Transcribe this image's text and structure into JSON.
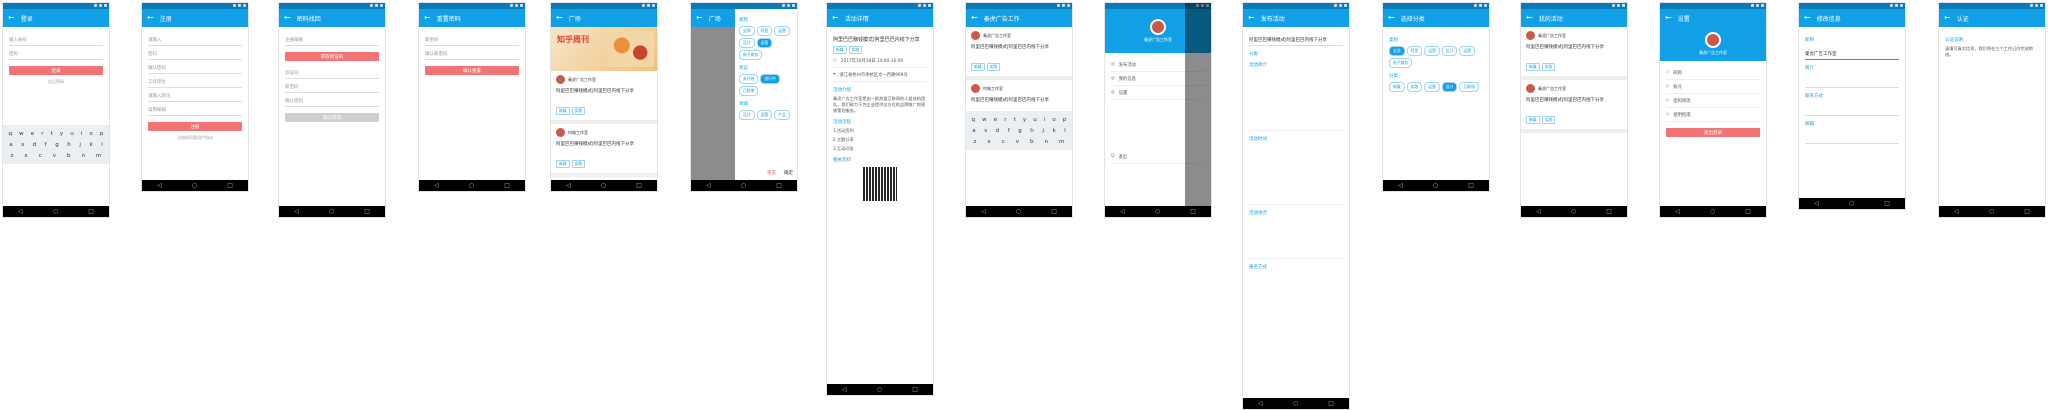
{
  "frames": [
    {
      "title": "登录",
      "f1": "输入账号",
      "f2": "密码",
      "btn": "登录",
      "link": "忘记密码"
    },
    {
      "title": "注册",
      "f1": "请输入",
      "f2": "密码",
      "f3": "确认密码",
      "f4": "工作单位",
      "f5": "请输入职位",
      "f6": "常用邮箱",
      "btn": "注册",
      "link": "注册即同意用户协议"
    },
    {
      "title": "密码找回",
      "f1": "注册邮箱",
      "btn1": "获取验证码",
      "f2": "验证码",
      "f3": "新密码",
      "f4": "确认密码",
      "btn2": "确认修改"
    },
    {
      "title": "重置密码",
      "f1": "新密码",
      "f2": "确认新密码",
      "btn": "确认重置"
    },
    {
      "title": "广场",
      "banner": "知乎周刊",
      "card1": {
        "name": "秦虎广告工作室",
        "text": "阿里巴巴赚钱模式|阿里巴巴内线下分享",
        "tags": [
          "新媒",
          "实践"
        ]
      },
      "card2": {
        "name": "何城工作室",
        "text": "阿里巴巴赚钱模式|阿里巴巴内线下分享",
        "tags": [
          "新媒",
          "实践"
        ]
      }
    },
    {
      "title": "广场",
      "s1": "类别",
      "c1": [
        "全部",
        "阿里",
        "运营",
        "设计",
        "运营",
        "电子商务"
      ],
      "s2": "状态",
      "c2": [
        "未开始",
        "进行中",
        "已结束"
      ],
      "s3": "领域",
      "c3": [
        "设计",
        "运营",
        "产品"
      ],
      "b1": "重置",
      "b2": "确定"
    },
    {
      "title": "活动详情",
      "head": "阿里巴巴赚钱模式|阿里巴巴内线下分享",
      "tags": [
        "新媒",
        "实践"
      ],
      "r1": "2017年10月18日 14:00-16:00",
      "r2": "浙江省杭州市余杭区文一西路969号",
      "sec1": "活动介绍",
      "para": "秦虎广告工作室是由一群热爱互联网的人组成的团队，我们致力于为企业提供全方位的品牌推广和营销策划服务。",
      "sec2": "活动流程",
      "lines": [
        "1.活动签到",
        "2.主题分享",
        "3.互动问答"
      ],
      "sec3": "相关资料"
    },
    {
      "title": "秦虎广告工作",
      "card1": {
        "name": "秦虎广告工作室",
        "text": "阿里巴巴赚钱模式|阿里巴巴内线下分享",
        "tags": [
          "新媒",
          "实践"
        ]
      },
      "card2": {
        "name": "何城工作室",
        "text": "阿里巴巴赚钱模式|阿里巴巴内线下分享",
        "tags": [
          "新媒",
          "实践"
        ]
      }
    },
    {
      "name": "秦虎广告工作室",
      "menu": [
        "发布活动",
        "我的信息",
        "设置",
        "退出"
      ]
    },
    {
      "title": "发布活动",
      "f1": "阿里巴巴赚钱模式|阿里巴巴内线下分享",
      "s1": "分类",
      "s2": "活动简介",
      "s3": "活动时间",
      "s4": "活动地点",
      "s5": "报名方式"
    },
    {
      "title": "选择分类",
      "s1": "类别",
      "c1": [
        "全部",
        "阿里",
        "运营",
        "设计",
        "运营",
        "电子商务"
      ],
      "s2": "分类",
      "c2": [
        "新媒",
        "实践",
        "运营",
        "设计",
        "互联网"
      ]
    },
    {
      "title": "我的活动",
      "card1": {
        "name": "秦虎广告工作室",
        "text": "阿里巴巴赚钱模式|阿里巴巴内线下分享",
        "tags": [
          "新媒",
          "实践"
        ]
      },
      "card2": {
        "name": "秦虎广告工作室",
        "text": "阿里巴巴赚钱模式|阿里巴巴内线下分享",
        "tags": [
          "新媒",
          "实践"
        ]
      }
    },
    {
      "title": "设置",
      "name": "秦虎广告工作室",
      "rows": [
        "昵称",
        "账号",
        "密码修改",
        "使用指南"
      ],
      "btn": "退出登录"
    },
    {
      "title": "修改信息",
      "s1": "昵称",
      "v1": "秦虎广告工作室",
      "s2": "简介",
      "s3": "联系方式",
      "s4": "邮箱"
    },
    {
      "title": "认证",
      "s1": "认证说明",
      "para": "请填写真实信息，我们将在三个工作日内完成审核。"
    }
  ]
}
